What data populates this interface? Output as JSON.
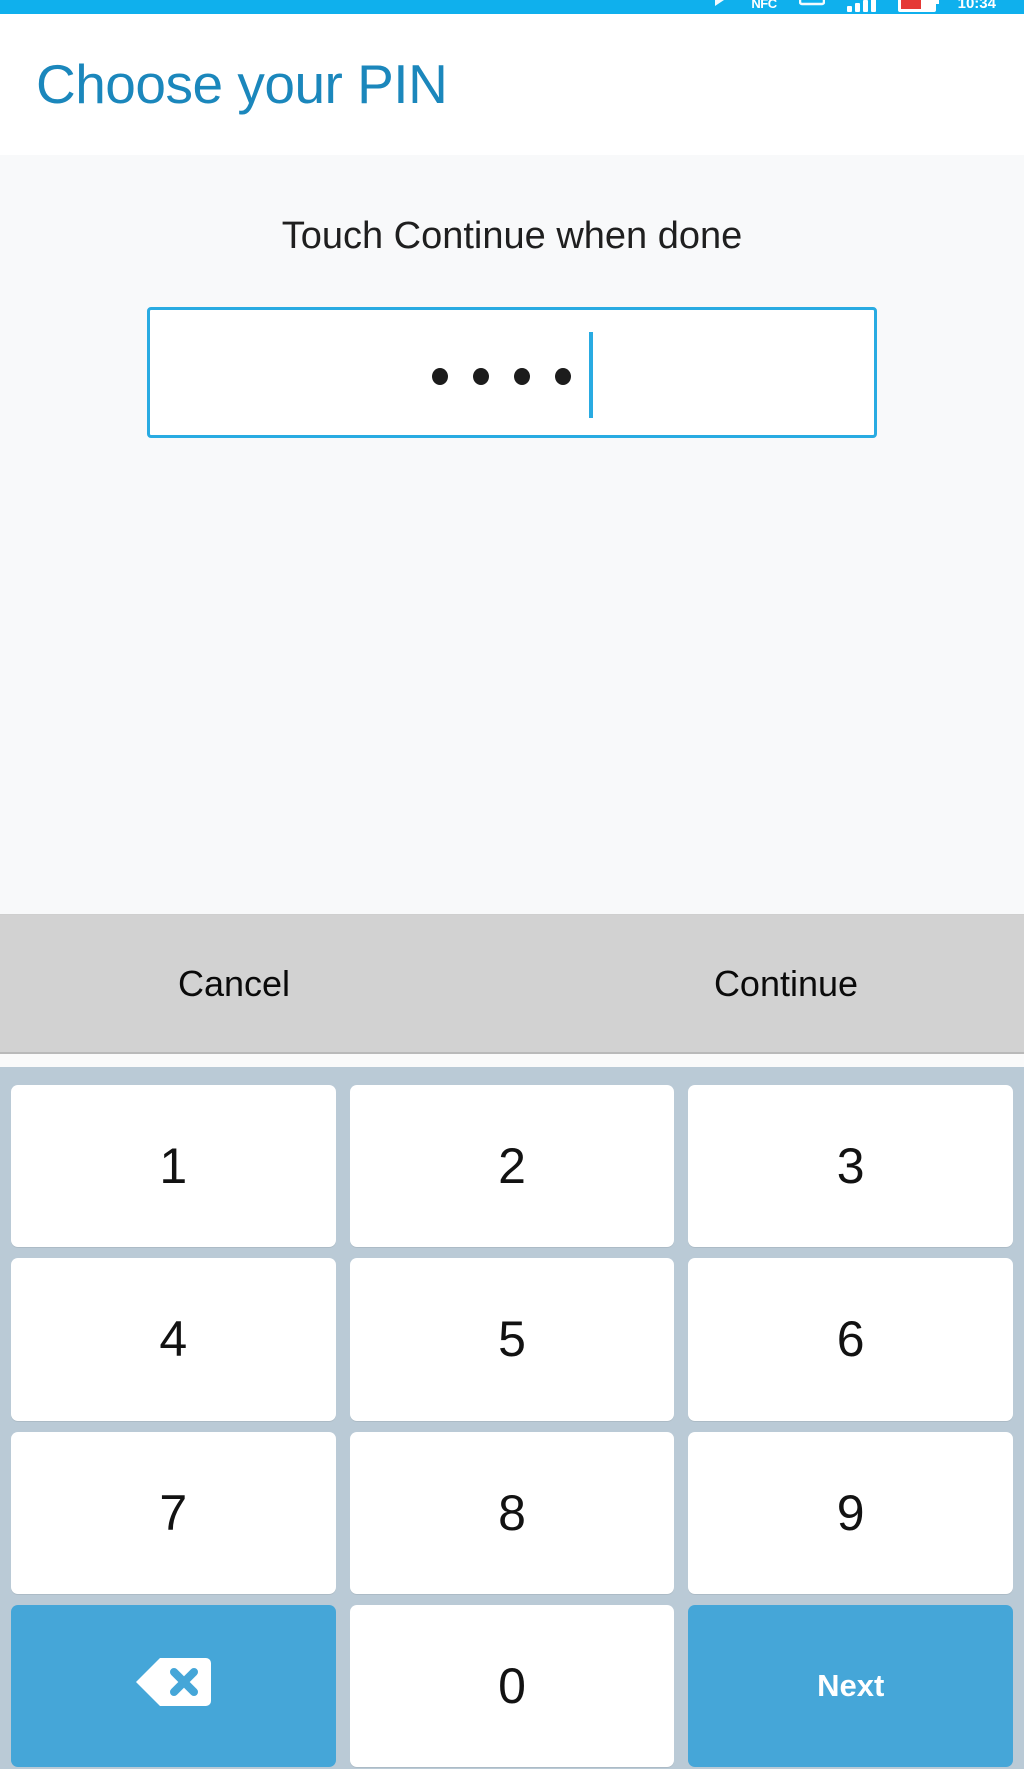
{
  "status_bar": {
    "background_color": "#0FB0ED",
    "icons": [
      {
        "name": "play-icon",
        "glyph": "▶"
      },
      {
        "name": "nfc-icon",
        "label": "NFC"
      },
      {
        "name": "sd-card-icon",
        "glyph": "▭"
      },
      {
        "name": "signal-bars-icon",
        "bars": 4
      },
      {
        "name": "battery-icon",
        "level_pct": 60
      },
      {
        "name": "clock-text",
        "label": "10:34"
      }
    ]
  },
  "header": {
    "title": "Choose your PIN",
    "title_color": "#1B87BC"
  },
  "main": {
    "instruction": "Touch Continue when done",
    "pin_input": {
      "entered_digits": 4,
      "masked_value": "••••",
      "placeholder": "",
      "border_color": "#29ABE2",
      "caret_visible": true
    }
  },
  "action_bar": {
    "background_color": "#D2D2D2",
    "cancel_label": "Cancel",
    "continue_label": "Continue"
  },
  "numpad": {
    "background_color": "#BACAD6",
    "key_color": "#FFFFFF",
    "action_key_color": "#45A6D8",
    "rows": [
      [
        {
          "name": "numpad-key-1",
          "label": "1",
          "type": "digit"
        },
        {
          "name": "numpad-key-2",
          "label": "2",
          "type": "digit"
        },
        {
          "name": "numpad-key-3",
          "label": "3",
          "type": "digit"
        }
      ],
      [
        {
          "name": "numpad-key-4",
          "label": "4",
          "type": "digit"
        },
        {
          "name": "numpad-key-5",
          "label": "5",
          "type": "digit"
        },
        {
          "name": "numpad-key-6",
          "label": "6",
          "type": "digit"
        }
      ],
      [
        {
          "name": "numpad-key-7",
          "label": "7",
          "type": "digit"
        },
        {
          "name": "numpad-key-8",
          "label": "8",
          "type": "digit"
        },
        {
          "name": "numpad-key-9",
          "label": "9",
          "type": "digit"
        }
      ],
      [
        {
          "name": "numpad-key-backspace",
          "label": "",
          "type": "backspace",
          "icon": "backspace-icon"
        },
        {
          "name": "numpad-key-0",
          "label": "0",
          "type": "digit"
        },
        {
          "name": "numpad-key-next",
          "label": "Next",
          "type": "action"
        }
      ]
    ]
  }
}
